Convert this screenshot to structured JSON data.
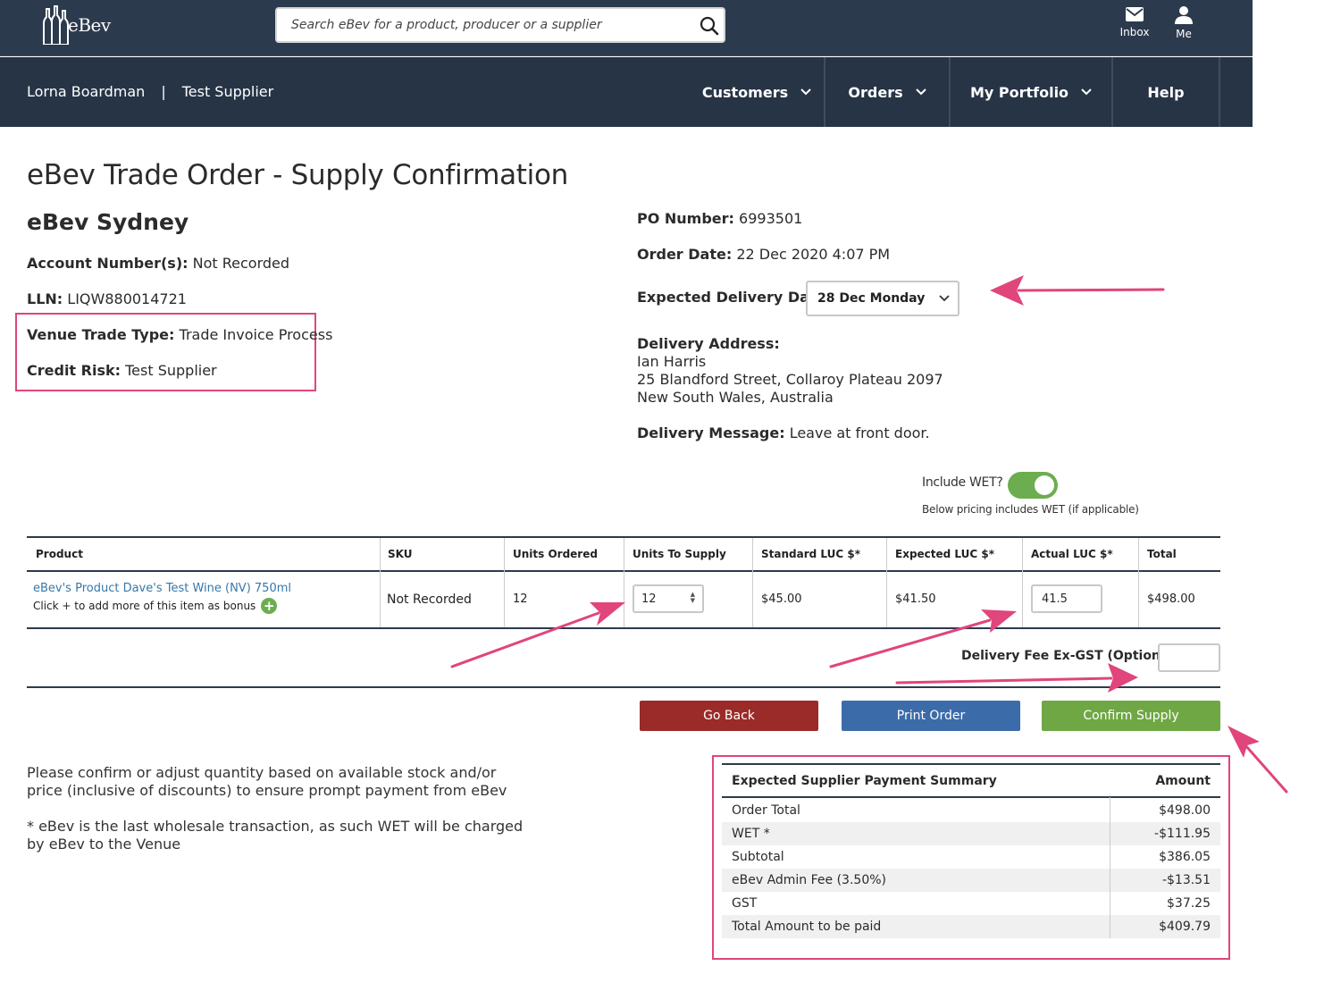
{
  "brand": {
    "logo_text": "eBev"
  },
  "search": {
    "placeholder": "Search eBev for a product, producer or a supplier"
  },
  "top_icons": {
    "inbox": "Inbox",
    "me": "Me"
  },
  "nav": {
    "user_name": "Lorna Boardman",
    "separator": "|",
    "company": "Test Supplier",
    "items": [
      "Customers",
      "Orders",
      "My Portfolio",
      "Help"
    ]
  },
  "page_title": "eBev Trade Order - Supply Confirmation",
  "venue": {
    "name": "eBev Sydney",
    "account_label": "Account Number(s):",
    "account_value": "Not Recorded",
    "lln_label": "LLN:",
    "lln_value": "LIQW880014721",
    "trade_type_label": "Venue Trade Type:",
    "trade_type_value": "Trade Invoice Process",
    "credit_label": "Credit Risk:",
    "credit_value": "Test Supplier"
  },
  "order": {
    "po_label": "PO Number:",
    "po_value": "6993501",
    "date_label": "Order Date:",
    "date_value": "22 Dec 2020 4:07 PM",
    "expected_label": "Expected Delivery Date:",
    "expected_value": "28 Dec Monday",
    "address_label": "Delivery Address:",
    "address_lines": [
      "Ian Harris",
      "25 Blandford Street, Collaroy Plateau 2097",
      "New South Wales, Australia"
    ],
    "message_label": "Delivery Message:",
    "message_value": "Leave at front door."
  },
  "wet": {
    "label": "Include WET?",
    "enabled": true,
    "note": "Below pricing includes WET (if applicable)"
  },
  "table": {
    "headers": [
      "Product",
      "SKU",
      "Units Ordered",
      "Units To Supply",
      "Standard LUC $*",
      "Expected LUC $*",
      "Actual LUC $*",
      "Total"
    ],
    "row": {
      "product": "eBev's Product Dave's Test Wine (NV) 750ml",
      "bonus_text": "Click + to add more of this item as bonus",
      "sku": "Not Recorded",
      "units_ordered": "12",
      "units_to_supply": "12",
      "standard_luc": "$45.00",
      "expected_luc": "$41.50",
      "actual_luc": "41.5",
      "total": "$498.00"
    }
  },
  "delivery_fee": {
    "label": "Delivery Fee Ex-GST (Optional)",
    "value": ""
  },
  "buttons": {
    "back": "Go Back",
    "print": "Print Order",
    "confirm": "Confirm Supply"
  },
  "notes": {
    "confirm": "Please confirm or adjust quantity based on available stock and/or price (inclusive of discounts) to ensure prompt payment from eBev",
    "wet": "* eBev is the last wholesale transaction, as such WET will be charged by eBev to the Venue"
  },
  "summary": {
    "title": "Expected Supplier Payment Summary",
    "amount_header": "Amount",
    "rows": [
      {
        "label": "Order Total",
        "amount": "$498.00"
      },
      {
        "label": "WET *",
        "amount": "-$111.95"
      },
      {
        "label": "Subtotal",
        "amount": "$386.05"
      },
      {
        "label": "eBev Admin Fee (3.50%)",
        "amount": "-$13.51"
      },
      {
        "label": "GST",
        "amount": "$37.25"
      },
      {
        "label": "Total Amount to be paid",
        "amount": "$409.79"
      }
    ]
  },
  "colors": {
    "header_bg": "#2c3a4e",
    "nav_bg": "#263446",
    "link": "#3678a9",
    "go_back": "#9a2b28",
    "print": "#3c6ba9",
    "confirm": "#6fa744",
    "annotation": "#e0457b"
  }
}
